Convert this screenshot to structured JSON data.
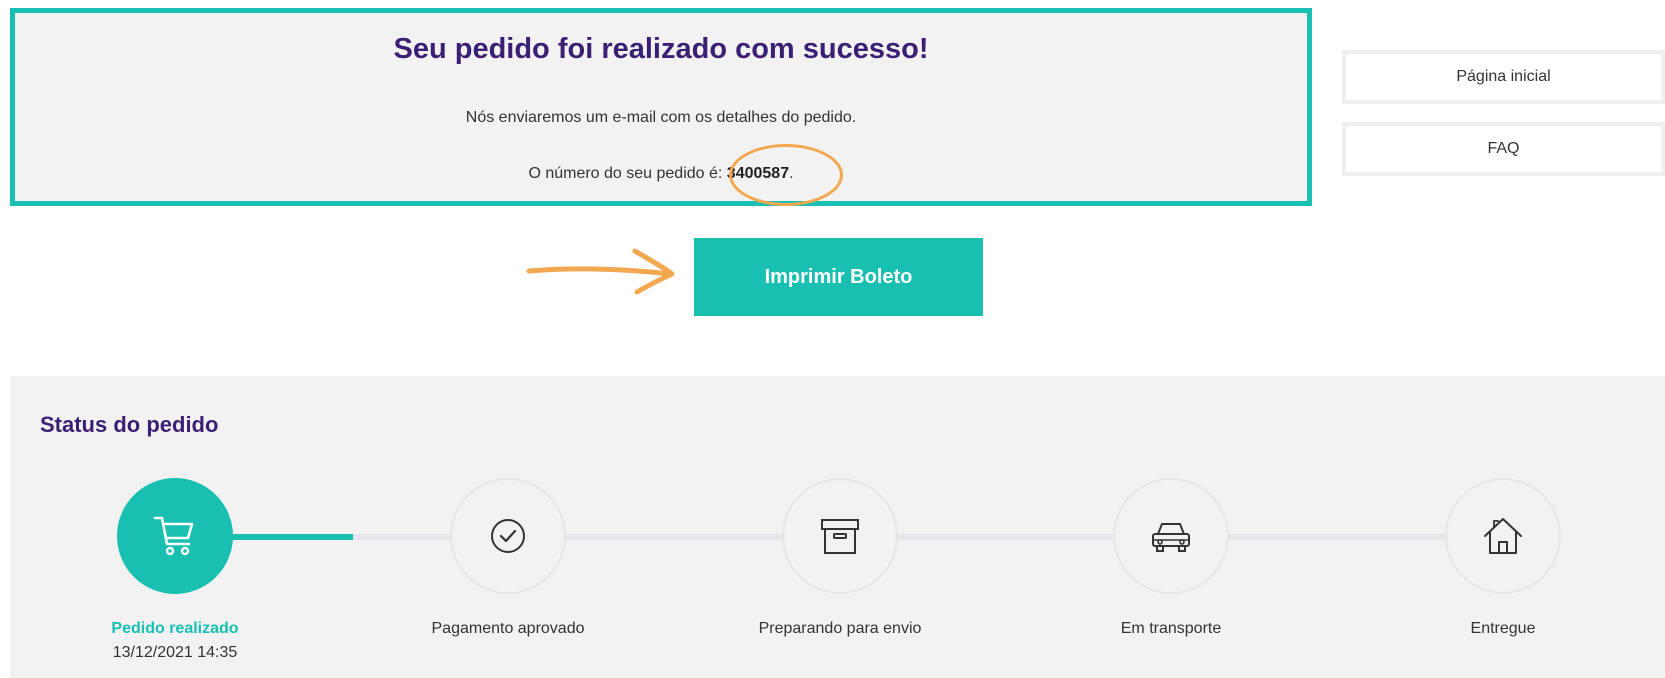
{
  "success": {
    "title": "Seu pedido foi realizado com sucesso!",
    "message": "Nós enviaremos um e-mail com os detalhes do pedido.",
    "order_prefix": "O número do seu pedido é: ",
    "order_number": "3400587",
    "order_suffix": "."
  },
  "side_links": {
    "home": "Página inicial",
    "faq": "FAQ"
  },
  "print_button": "Imprimir Boleto",
  "status": {
    "title": "Status do pedido",
    "steps": [
      {
        "label": "Pedido realizado",
        "date": "13/12/2021 14:35",
        "icon": "cart-icon",
        "active": true
      },
      {
        "label": "Pagamento aprovado",
        "icon": "check-circle-icon",
        "active": false
      },
      {
        "label": "Preparando para envio",
        "icon": "box-icon",
        "active": false
      },
      {
        "label": "Em transporte",
        "icon": "car-icon",
        "active": false
      },
      {
        "label": "Entregue",
        "icon": "house-icon",
        "active": false
      }
    ]
  },
  "colors": {
    "accent": "#19bfb0",
    "title_purple": "#3b1f74",
    "annotation_orange": "#f2a850"
  }
}
